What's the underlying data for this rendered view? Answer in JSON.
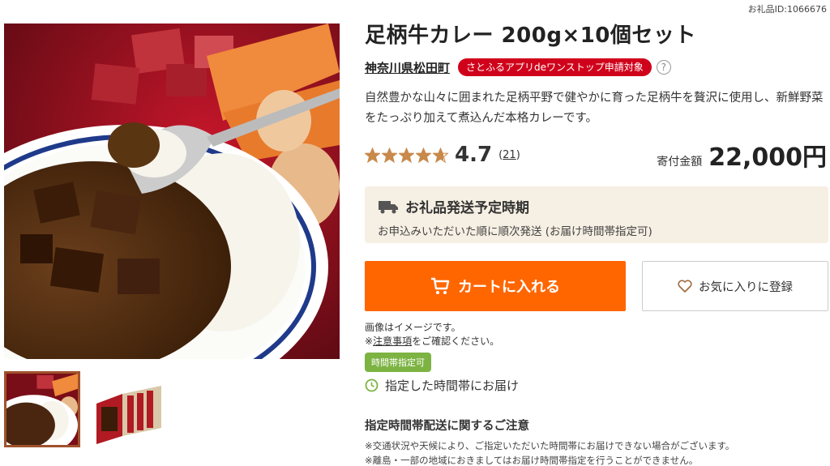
{
  "gift_id": "お礼品ID:1066676",
  "product": {
    "title": "足柄牛カレー 200g×10個セット",
    "municipality": "神奈川県松田町",
    "badge": "さとふるアプリdeワンストップ申請対象",
    "help": "?",
    "description": "自然豊かな山々に囲まれた足柄平野で健やかに育った足柄牛を贅沢に使用し、新鮮野菜をたっぷり加えて煮込んだ本格カレーです。"
  },
  "rating": {
    "value": "4.7",
    "score": 4.7,
    "max": 5,
    "reviews_label": "(21)",
    "reviews": "21"
  },
  "price": {
    "label": "寄付金額",
    "amount": "22,000円"
  },
  "shipping": {
    "title": "お礼品発送予定時期",
    "note": "お申込みいただいた順に順次発送 (お届け時間帯指定可)"
  },
  "buttons": {
    "cart": "カートに入れる",
    "favorite": "お気に入りに登録"
  },
  "image_note": {
    "line1": "画像はイメージです。",
    "prefix": "※",
    "link": "注意事項",
    "suffix": "をご確認ください。"
  },
  "time_slot": {
    "badge": "時間帯指定可",
    "text": "指定した時間帯にお届け"
  },
  "notice": {
    "title": "指定時間帯配送に関するご注意",
    "line1": "※交通状況や天候により、ご指定いただいた時間帯にお届けできない場合がございます。",
    "line2": "※離島・一部の地域におきましてはお届け時間帯指定を行うことができません。"
  },
  "colors": {
    "accent": "#ff6600",
    "badge_red": "#d0021b",
    "time_green": "#7cb342",
    "star": "#c8894a",
    "ship_bg": "#f6efe3"
  },
  "icons": {
    "truck": "truck-icon",
    "cart": "cart-icon",
    "heart": "heart-icon",
    "clock": "clock-icon",
    "star": "star-icon"
  }
}
